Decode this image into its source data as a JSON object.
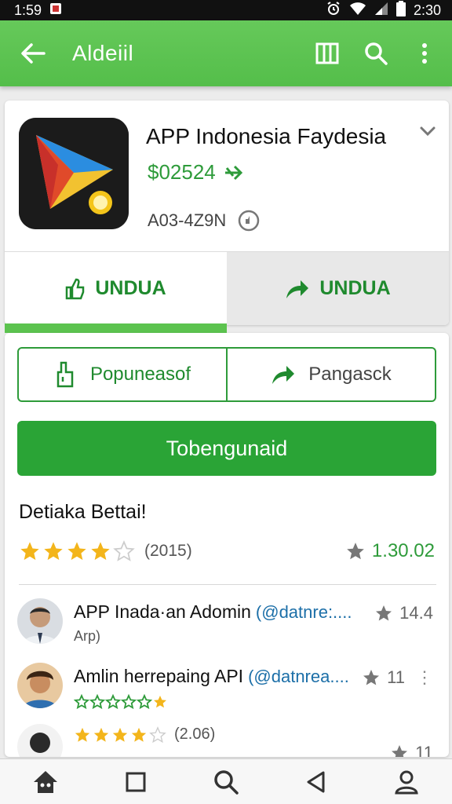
{
  "status_bar": {
    "time_left": "1:59",
    "time_right": "2:30"
  },
  "app_bar": {
    "title": "Aldeiil"
  },
  "app": {
    "name": "APP Indonesia Faydesia",
    "price": "$02524",
    "code": "A03-4Z9N",
    "download_left": "UNDUA",
    "download_right": "UNDUA"
  },
  "actions": {
    "segment_left": "Popuneasof",
    "segment_right": "Pangasck",
    "cta": "Tobengunaid"
  },
  "details": {
    "title": "Detiaka Bettai!",
    "stars": 4,
    "count": "(2015)",
    "score": "1.30.02"
  },
  "reviews": [
    {
      "name": "APP Inada·an Adomin",
      "handle": "(@datnre:....",
      "sub": "Arp)",
      "score": "14.4"
    },
    {
      "name": "Amlin herrepaing API",
      "handle": "(@datnrea....",
      "score": "11"
    },
    {
      "stars": 4,
      "sub": "(2.06)",
      "score": "11"
    }
  ],
  "colors": {
    "accent": "#54be4a",
    "primary_green": "#2aa436",
    "star": "#f3b51b",
    "link": "#1c6fa8"
  }
}
